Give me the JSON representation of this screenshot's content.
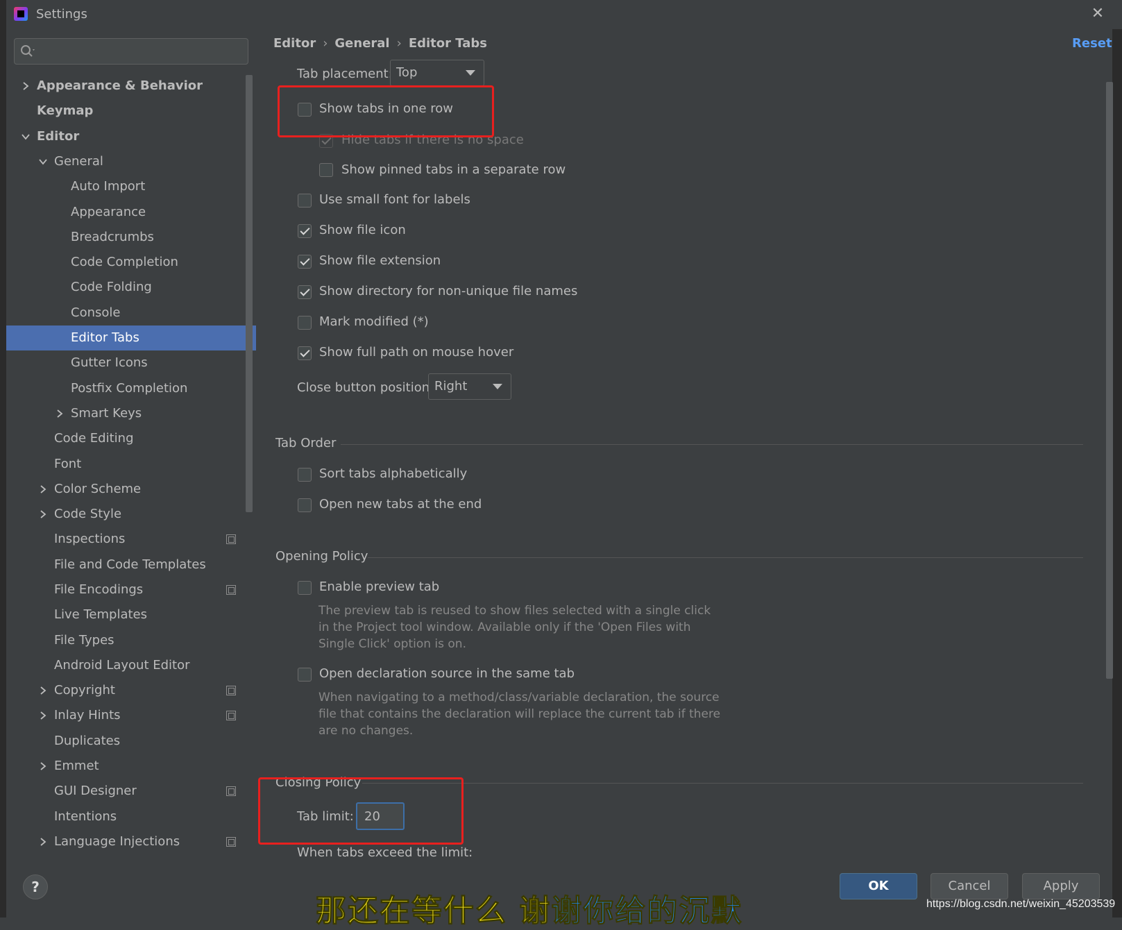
{
  "window": {
    "title": "Settings"
  },
  "search": {
    "placeholder": ""
  },
  "sidebar": {
    "items": [
      {
        "label": "Appearance & Behavior",
        "bold": true,
        "chevron": "right"
      },
      {
        "label": "Keymap",
        "bold": true,
        "chevron": ""
      },
      {
        "label": "Editor",
        "bold": true,
        "chevron": "down"
      },
      {
        "label": "General",
        "chevron": "down"
      },
      {
        "label": "Auto Import"
      },
      {
        "label": "Appearance"
      },
      {
        "label": "Breadcrumbs"
      },
      {
        "label": "Code Completion"
      },
      {
        "label": "Code Folding"
      },
      {
        "label": "Console"
      },
      {
        "label": "Editor Tabs",
        "selected": true
      },
      {
        "label": "Gutter Icons"
      },
      {
        "label": "Postfix Completion"
      },
      {
        "label": "Smart Keys",
        "chevron": "right"
      },
      {
        "label": "Code Editing"
      },
      {
        "label": "Font"
      },
      {
        "label": "Color Scheme",
        "chevron": "right"
      },
      {
        "label": "Code Style",
        "chevron": "right"
      },
      {
        "label": "Inspections",
        "icon": "copy-icon"
      },
      {
        "label": "File and Code Templates"
      },
      {
        "label": "File Encodings",
        "icon": "copy-icon"
      },
      {
        "label": "Live Templates"
      },
      {
        "label": "File Types"
      },
      {
        "label": "Android Layout Editor"
      },
      {
        "label": "Copyright",
        "chevron": "right",
        "icon": "copy-icon"
      },
      {
        "label": "Inlay Hints",
        "chevron": "right",
        "icon": "copy-icon"
      },
      {
        "label": "Duplicates"
      },
      {
        "label": "Emmet",
        "chevron": "right"
      },
      {
        "label": "GUI Designer",
        "icon": "copy-icon"
      },
      {
        "label": "Intentions"
      },
      {
        "label": "Language Injections",
        "chevron": "right",
        "icon": "copy-icon"
      }
    ]
  },
  "breadcrumb": {
    "items": [
      "Editor",
      "General",
      "Editor Tabs"
    ],
    "separator": "›"
  },
  "reset_label": "Reset",
  "settings": {
    "tab_placement_label": "Tab placement:",
    "tab_placement_value": "Top",
    "show_tabs_one_row": {
      "label": "Show tabs in one row",
      "checked": false
    },
    "hide_tabs_no_space": {
      "label": "Hide tabs if there is no space",
      "checked": true,
      "disabled": true
    },
    "show_pinned_separate": {
      "label": "Show pinned tabs in a separate row",
      "checked": false
    },
    "small_font": {
      "label": "Use small font for labels",
      "checked": false
    },
    "show_file_icon": {
      "label": "Show file icon",
      "checked": true
    },
    "show_file_ext": {
      "label": "Show file extension",
      "checked": true
    },
    "show_directory": {
      "label": "Show directory for non-unique file names",
      "checked": true
    },
    "mark_modified": {
      "label": "Mark modified (*)",
      "checked": false
    },
    "full_path_hover": {
      "label": "Show full path on mouse hover",
      "checked": true
    },
    "close_button_label": "Close button position:",
    "close_button_value": "Right"
  },
  "tab_order": {
    "title": "Tab Order",
    "sort_alpha": {
      "label": "Sort tabs alphabetically",
      "checked": false
    },
    "open_at_end": {
      "label": "Open new tabs at the end",
      "checked": false
    }
  },
  "opening_policy": {
    "title": "Opening Policy",
    "preview_tab": {
      "label": "Enable preview tab",
      "checked": false
    },
    "preview_help": [
      "The preview tab is reused to show files selected with a single click",
      "in the Project tool window. Available only if the 'Open Files with",
      "Single Click' option is on."
    ],
    "declaration_same_tab": {
      "label": "Open declaration source in the same tab",
      "checked": false
    },
    "declaration_help": [
      "When navigating to a method/class/variable declaration, the source",
      "file that contains the declaration will replace the current tab if there",
      "are no changes."
    ]
  },
  "closing_policy": {
    "title": "Closing Policy",
    "tab_limit_label": "Tab limit:",
    "tab_limit_value": "20",
    "exceed_label": "When tabs exceed the limit:"
  },
  "footer": {
    "help": "?",
    "ok": "OK",
    "cancel": "Cancel",
    "apply": "Apply"
  },
  "overlay": {
    "subtitle_yellow": "那还在等什么 谢",
    "subtitle_blue": "谢你给的沉默",
    "watermark": "https://blog.csdn.net/weixin_45203539"
  },
  "colors": {
    "background": "#3c3f41",
    "selection": "#4b6eaf",
    "link": "#589df6",
    "highlight_box": "#e8201e",
    "primary_button": "#365880"
  }
}
